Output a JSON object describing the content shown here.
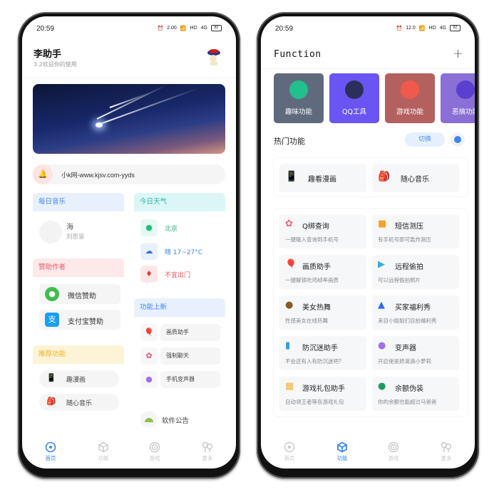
{
  "status": {
    "time": "20:59",
    "left_speed": "2.00",
    "right_speed": "12.0",
    "network": "HD",
    "signal": "4G",
    "battery": "82"
  },
  "home": {
    "title": "李助手",
    "subtitle": "3.2欢迎你的使用",
    "notice": "小k网-www.kjsv.com-yyds",
    "music": {
      "header": "每日音乐",
      "song": "海",
      "artist": "刘思鉴"
    },
    "weather": {
      "header": "今日天气",
      "city": "北京",
      "condition": "晴 17~27°C",
      "advice": "不宜出门"
    },
    "sponsor": {
      "header": "赞助作者",
      "wechat": "微信赞助",
      "alipay": "支付宝赞助"
    },
    "new_features": {
      "header": "功能上新",
      "items": [
        "画质助手",
        "强制聊天",
        "手机变声器"
      ]
    },
    "recommend": {
      "header": "推荐功能",
      "items": [
        "趣漫画",
        "随心音乐"
      ]
    },
    "announcement": "软件公告"
  },
  "function": {
    "title": "Function",
    "add_icon": "plus-icon",
    "categories": [
      {
        "label": "趣味功能",
        "color": "#5f6b7d"
      },
      {
        "label": "QQ工具",
        "color": "#6a55f2"
      },
      {
        "label": "游戏功能",
        "color": "#b4605f"
      },
      {
        "label": "恶搞功能",
        "color": "#8a6fd6"
      }
    ],
    "hot": {
      "title": "热门功能",
      "switch_label": "切换",
      "items": [
        "趣看漫画",
        "随心音乐"
      ]
    },
    "grid": [
      {
        "title": "Q绑查询",
        "desc": "一键输入查询到手机号"
      },
      {
        "title": "短信测压",
        "desc": "有手机号即可轰炸测压"
      },
      {
        "title": "画质助手",
        "desc": "一键解锁吃鸡帧率画质"
      },
      {
        "title": "远程偷拍",
        "desc": "可以远程偷拍照片"
      },
      {
        "title": "美女热舞",
        "desc": "性感美女在线热舞"
      },
      {
        "title": "买家福利秀",
        "desc": "来自小姐姐们自拍福利秀"
      },
      {
        "title": "防沉迷助手",
        "desc": "不会还有人有防沉迷吧?"
      },
      {
        "title": "变声器",
        "desc": "开启使是娇滴滴小萝莉"
      },
      {
        "title": "游戏礼包助手",
        "desc": "自动领王者等各游戏礼包"
      },
      {
        "title": "余额伪装",
        "desc": "你的余额也能超过马爸爸"
      }
    ]
  },
  "tabs": [
    {
      "label": "首页",
      "icon": "home-circle-icon"
    },
    {
      "label": "功能",
      "icon": "cube-icon"
    },
    {
      "label": "游戏",
      "icon": "game-swirl-icon"
    },
    {
      "label": "更多",
      "icon": "more-balloons-icon"
    }
  ],
  "colors": {
    "accent": "#3d86f0",
    "inactive": "#c8c8c8"
  }
}
